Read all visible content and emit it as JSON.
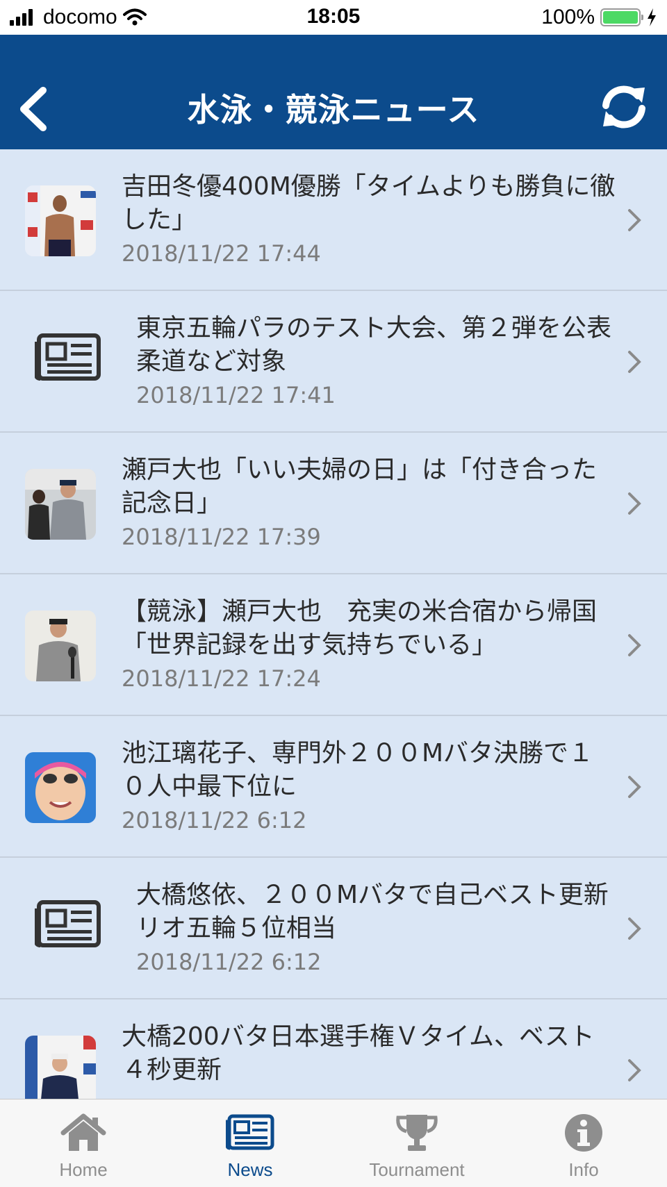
{
  "status_bar": {
    "carrier": "docomo",
    "time": "18:05",
    "battery": "100%"
  },
  "header": {
    "title": "水泳・競泳ニュース",
    "back_icon": "chevron-left-icon",
    "refresh_icon": "refresh-icon"
  },
  "news": [
    {
      "title": "吉田冬優400M優勝「タイムよりも勝負に徹した」",
      "date": "2018/11/22 17:44",
      "thumbnail": "photo"
    },
    {
      "title": "東京五輪パラのテスト大会、第２弾を公表　柔道など対象",
      "date": "2018/11/22 17:41",
      "thumbnail": "newspaper-icon"
    },
    {
      "title": "瀬戸大也「いい夫婦の日」は「付き合った記念日」",
      "date": "2018/11/22 17:39",
      "thumbnail": "photo"
    },
    {
      "title": "【競泳】瀬戸大也　充実の米合宿から帰国「世界記録を出す気持ちでいる」",
      "date": "2018/11/22 17:24",
      "thumbnail": "photo"
    },
    {
      "title": "池江璃花子、専門外２００Mバタ決勝で１０人中最下位に",
      "date": "2018/11/22 6:12",
      "thumbnail": "photo"
    },
    {
      "title": "大橋悠依、２００Mバタで自己ベスト更新　リオ五輪５位相当",
      "date": "2018/11/22 6:12",
      "thumbnail": "newspaper-icon"
    },
    {
      "title": "大橋200バタ日本選手権Ｖタイム、ベスト４秒更新",
      "date": "",
      "thumbnail": "photo"
    }
  ],
  "tabs": [
    {
      "label": "Home",
      "icon": "home-icon",
      "active": false
    },
    {
      "label": "News",
      "icon": "newspaper-icon",
      "active": true
    },
    {
      "label": "Tournament",
      "icon": "trophy-icon",
      "active": false
    },
    {
      "label": "Info",
      "icon": "info-icon",
      "active": false
    }
  ],
  "colors": {
    "header": "#0c4b8c",
    "list_background": "#dae6f5",
    "active_tab": "#0c4b8c",
    "inactive_tab": "#8e8e8e"
  }
}
